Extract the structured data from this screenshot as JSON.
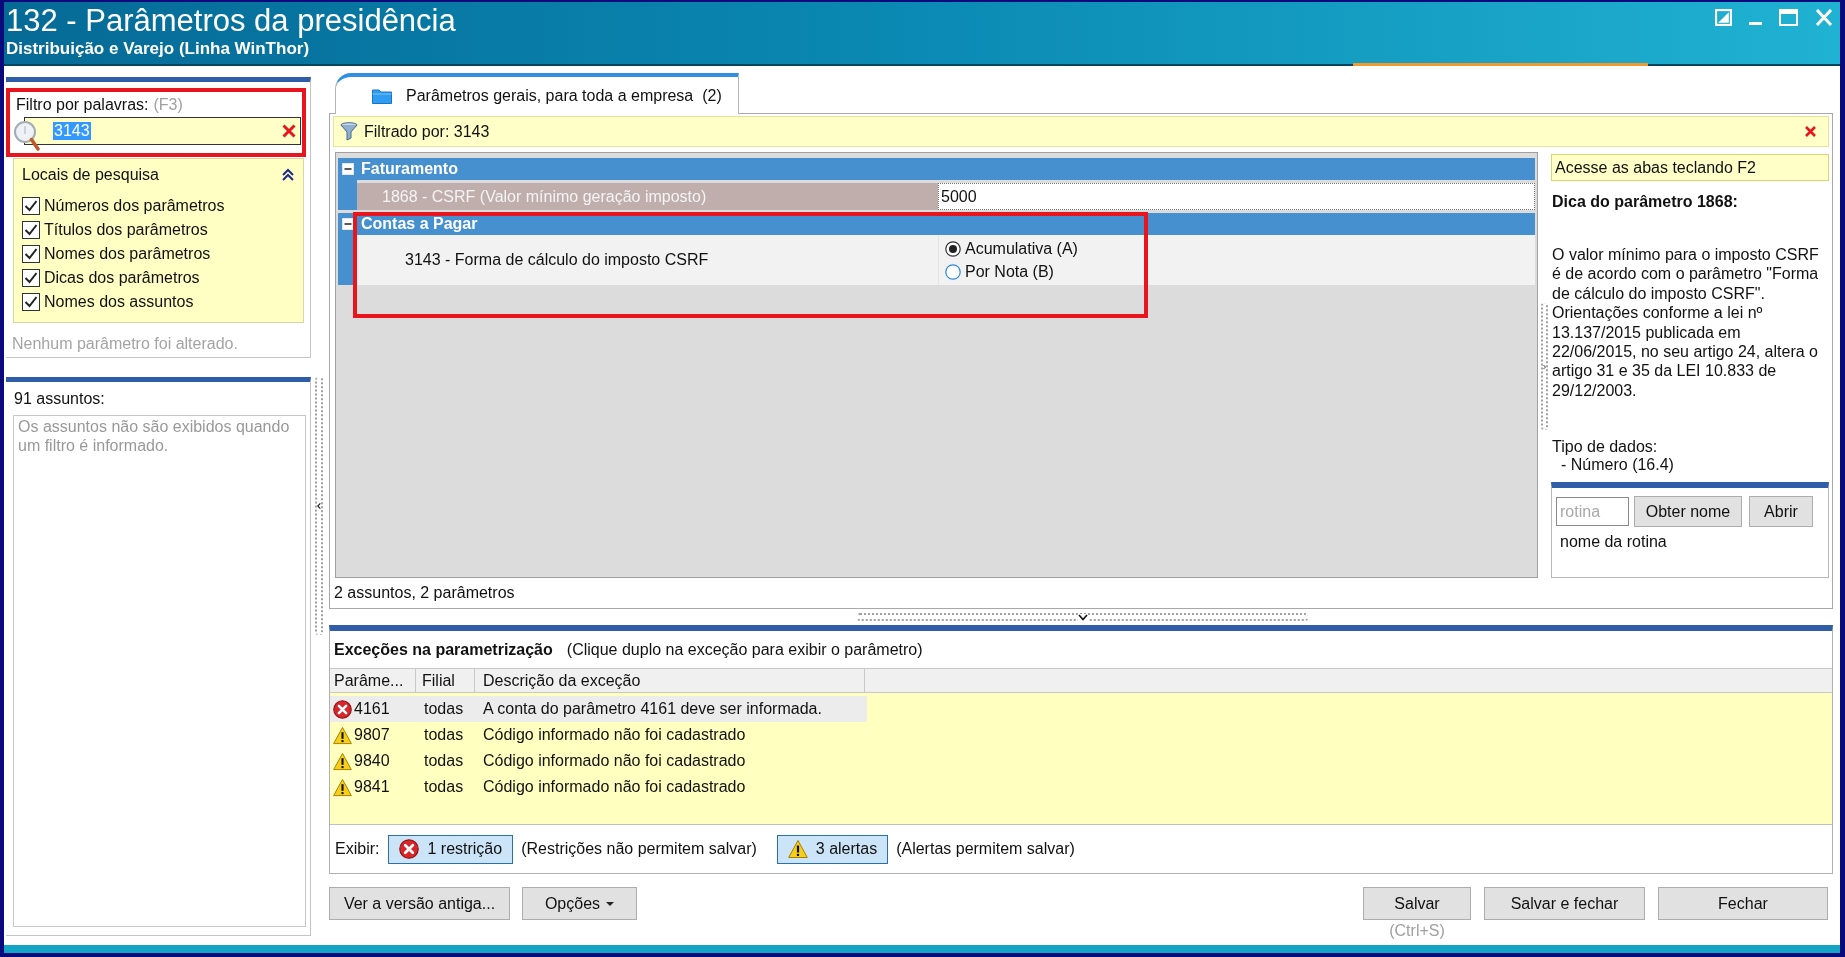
{
  "window": {
    "title": "132 - Parâmetros da presidência",
    "subtitle": "Distribuição e Varejo (Linha WinThor)"
  },
  "filter": {
    "label": "Filtro por palavras:",
    "shortcut": "(F3)",
    "value": "3143",
    "text_selected": true,
    "highlighted": true
  },
  "search_locations": {
    "title": "Locais de pesquisa",
    "expanded": true,
    "items": [
      {
        "label": "Números dos parâmetros",
        "checked": true
      },
      {
        "label": "Títulos dos parâmetros",
        "checked": true
      },
      {
        "label": "Nomes dos parâmetros",
        "checked": true
      },
      {
        "label": "Dicas dos parâmetros",
        "checked": true
      },
      {
        "label": "Nomes dos assuntos",
        "checked": true
      }
    ]
  },
  "change_status": "Nenhum parâmetro foi alterado.",
  "subjects": {
    "count_label": "91 assuntos:",
    "message": "Os assuntos não são exibidos quando um filtro é informado."
  },
  "tabs": [
    {
      "label": "Parâmetros gerais, para toda a empresa",
      "count": "(2)",
      "selected": true
    }
  ],
  "filter_bar": {
    "text": "Filtrado por: 3143"
  },
  "groups": [
    {
      "title": "Faturamento",
      "expanded": true,
      "highlighted": false,
      "parameters": [
        {
          "kind": "value",
          "label": "1868 - CSRF (Valor mínimo geração imposto)",
          "value": "5000",
          "selected": true
        }
      ]
    },
    {
      "title": "Contas a Pagar",
      "expanded": true,
      "highlighted": true,
      "parameters": [
        {
          "kind": "radio",
          "label": "3143 - Forma de cálculo do imposto CSRF",
          "selected": false,
          "options": [
            {
              "label": "Acumulativa (A)",
              "selected": true
            },
            {
              "label": "Por Nota (B)",
              "selected": false
            }
          ]
        }
      ]
    }
  ],
  "summary": "2 assuntos, 2 parâmetros",
  "hint_panel": {
    "banner": "Acesse as abas teclando F2",
    "title": "Dica do parâmetro 1868:",
    "text": "O valor mínimo para o imposto CSRF é de acordo com o parâmetro \"Forma de cálculo do imposto CSRF\". Orientações conforme a lei nº 13.137/2015 publicada em 22/06/2015, no seu artigo 24, altera o artigo 31 e 35 da LEI 10.833 de 29/12/2003.",
    "data_type_label": "Tipo de dados:",
    "data_type": "- Número (16.4)"
  },
  "routine": {
    "placeholder": "rotina",
    "buttons": [
      "Obter nome",
      "Abrir"
    ],
    "name_label": "nome da rotina"
  },
  "exceptions": {
    "title": "Exceções na parametrização",
    "hint": "(Clique duplo na exceção para exibir o parâmetro)",
    "columns": [
      "Parâme...",
      "Filial",
      "Descrição da exceção"
    ],
    "rows": [
      {
        "kind": "restriction",
        "parameter": "4161",
        "branch": "todas",
        "description": "A conta do parâmetro 4161 deve ser informada.",
        "selected": true
      },
      {
        "kind": "alert",
        "parameter": "9807",
        "branch": "todas",
        "description": "Código informado não foi cadastrado",
        "selected": false
      },
      {
        "kind": "alert",
        "parameter": "9840",
        "branch": "todas",
        "description": "Código informado não foi cadastrado",
        "selected": false
      },
      {
        "kind": "alert",
        "parameter": "9841",
        "branch": "todas",
        "description": "Código informado não foi cadastrado",
        "selected": false
      }
    ],
    "show_label": "Exibir:",
    "toggles": [
      {
        "kind": "restriction",
        "label": "1 restrição",
        "note": "(Restrições não permitem salvar)",
        "on": true
      },
      {
        "kind": "alert",
        "label": "3 alertas",
        "note": "(Alertas permitem salvar)",
        "on": true
      }
    ]
  },
  "buttons_left": [
    {
      "kind": "plain",
      "label": "Ver a versão antiga..."
    },
    {
      "kind": "dropdown",
      "label": "Opções"
    }
  ],
  "buttons_right": [
    {
      "label": "Salvar",
      "shortcut": "(Ctrl+S)"
    },
    {
      "label": "Salvar e fechar"
    },
    {
      "label": "Fechar"
    }
  ]
}
